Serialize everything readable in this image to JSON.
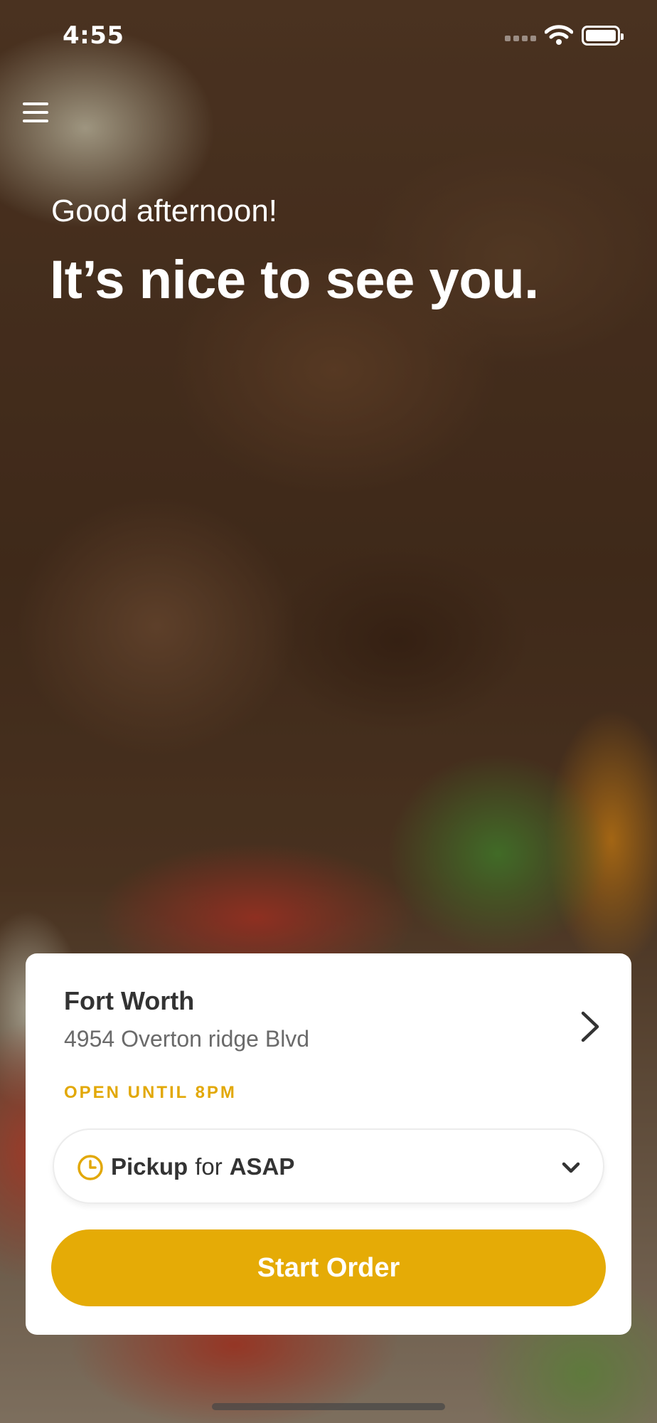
{
  "status_bar": {
    "time": "4:55"
  },
  "header": {
    "greeting": "Good afternoon!",
    "headline": "It’s nice to see you."
  },
  "location_card": {
    "store_name": "Fort Worth",
    "address": "4954 Overton ridge Blvd",
    "hours": "OPEN UNTIL 8PM",
    "order_mode": {
      "type": "Pickup",
      "connector": "for",
      "time": "ASAP"
    },
    "cta": "Start Order"
  },
  "icons": [
    "menu-icon",
    "wifi-icon",
    "battery-icon",
    "chevron-right-icon",
    "clock-icon",
    "chevron-down-icon"
  ],
  "colors": {
    "accent": "#e5ab06",
    "card": "#ffffff",
    "text_dark": "#333333",
    "text_muted": "#6a6a6a"
  }
}
